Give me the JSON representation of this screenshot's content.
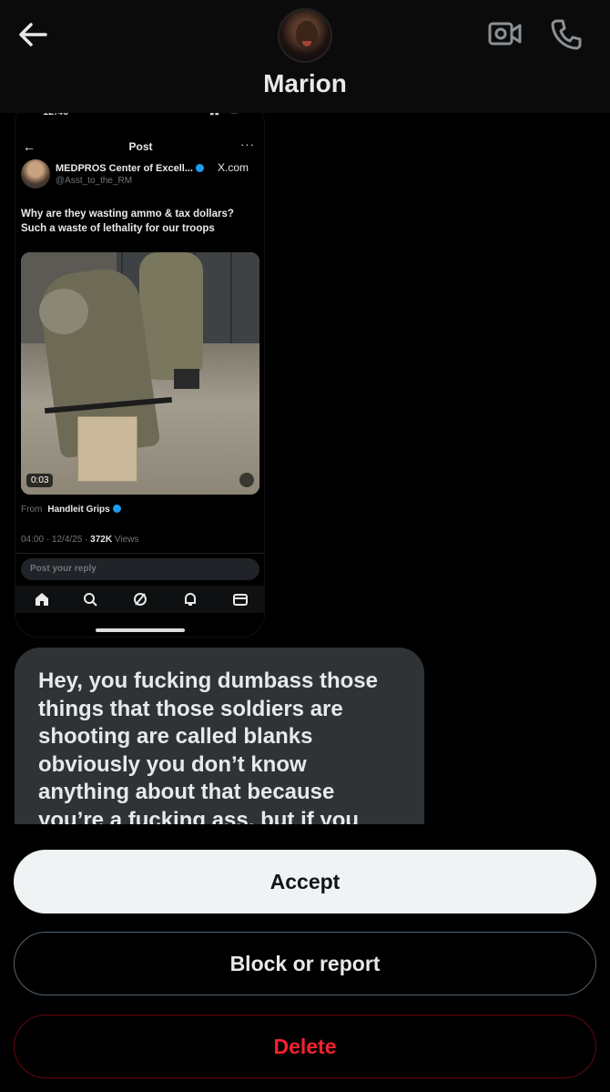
{
  "header": {
    "contact_name": "Marion",
    "back_icon": "back-arrow-icon",
    "video_icon": "video-call-icon",
    "call_icon": "phone-icon"
  },
  "shared_post": {
    "status_time": "12:46",
    "page_title": "Post",
    "author_name": "MEDPROS Center of Excell...",
    "author_handle": "@Asst_to_the_RM",
    "source_label": "X.com",
    "text": "Why are they wasting ammo & tax dollars? Such a waste of lethality for our troops",
    "video_duration": "0:03",
    "from_label": "From",
    "from_name": "Handleit Grips",
    "meta_time": "04:00 · 12/4/25 · ",
    "meta_views": "372K",
    "meta_views_label": " Views",
    "reply_placeholder": "Post your reply"
  },
  "message": {
    "text": "Hey, you fucking dumbass those things that those soldiers are shooting are called blanks obviously you don’t know anything about that because you’re a fucking ass. but if you"
  },
  "actions": {
    "accept": "Accept",
    "block": "Block or report",
    "delete": "Delete"
  },
  "colors": {
    "accept_bg": "#eff3f4",
    "delete_text": "#f4212e",
    "bubble_bg": "#2f3336"
  }
}
